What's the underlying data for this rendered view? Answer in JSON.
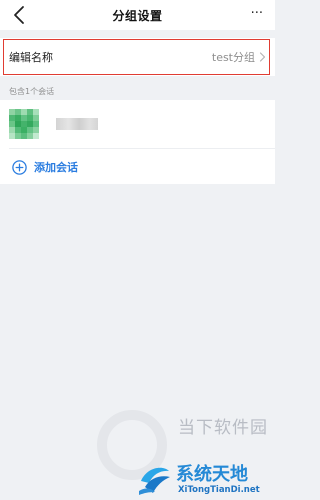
{
  "header": {
    "title": "分组设置",
    "back_icon": "chevron-left-icon",
    "more_label": "···"
  },
  "group_name": {
    "label": "编辑名称",
    "value": "test分组",
    "chevron_icon": "chevron-right-icon",
    "highlight_color": "#e03c32"
  },
  "section": {
    "label": "包含1个会话"
  },
  "conversations": [
    {
      "name": "",
      "avatar_icon": "pixelated-avatar-icon"
    }
  ],
  "add_conversation": {
    "label": "添加会话",
    "icon": "plus-circle-icon",
    "color": "#2b7de0"
  },
  "watermark": {
    "top_text": "当下软件园",
    "main_text": "系统天地",
    "sub_text": "XiTongTianDi.net"
  }
}
